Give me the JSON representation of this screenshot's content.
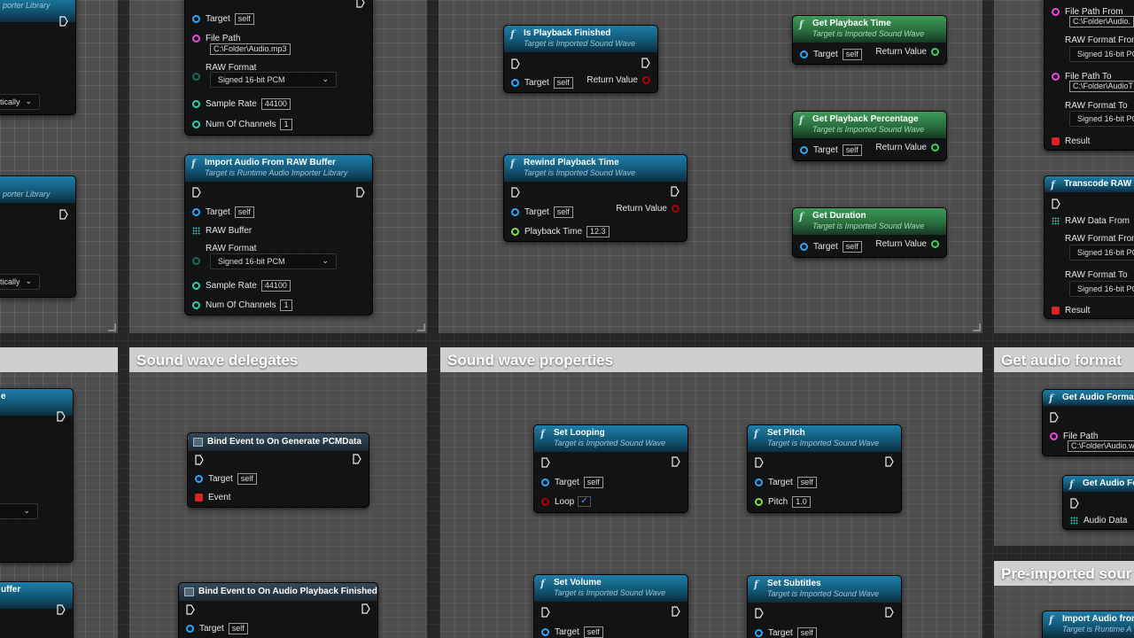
{
  "comments": {
    "sound_wave_delegates": "Sound wave delegates",
    "sound_wave_properties": "Sound wave properties",
    "get_audio_format": "Get audio format",
    "pre_imported_sound": "Pre-imported sour"
  },
  "common": {
    "target": "Target",
    "self": "self",
    "return_value": "Return Value",
    "imported_sound_wave": "Target is Imported Sound Wave",
    "runtime_lib": "Target is Runtime Audio Importer Library",
    "runtime_lib_cut": "Target is Runtime A",
    "raw_format": "RAW Format",
    "signed16": "Signed 16-bit PCM",
    "signed16_cut": "Signed 16-bit PC",
    "sample_rate": "Sample Rate",
    "sample_rate_val": "44100",
    "num_channels": "Num Of Channels",
    "num_channels_val": "1",
    "file_path": "File Path",
    "file_path_val": "C:\\Folder\\Audio.mp3",
    "file_path_val_cut": "C:\\Folder\\Audio.w",
    "result": "Result",
    "event": "Event",
    "tically": "tically",
    "porter_lib": "porter Library",
    "uffer": "uffer",
    "e": "e"
  },
  "nodes": {
    "import_raw": {
      "title": "Import Audio From RAW Buffer",
      "raw_buffer": "RAW Buffer"
    },
    "is_finished": {
      "title": "Is Playback Finished"
    },
    "rewind": {
      "title": "Rewind Playback Time",
      "playback_time": "Playback Time",
      "playback_time_val": "12.3"
    },
    "get_time": {
      "title": "Get Playback Time"
    },
    "get_pct": {
      "title": "Get Playback Percentage"
    },
    "get_duration": {
      "title": "Get Duration"
    },
    "transcode_file": {
      "path_from": "File Path From",
      "path_from_val": "C:\\Folder\\Audio.",
      "raw_from": "RAW Format From",
      "path_to": "File Path To",
      "path_to_val": "C:\\Folder\\AudioT",
      "raw_to": "RAW Format To"
    },
    "transcode_raw": {
      "title": "Transcode RAW Da",
      "raw_data_from": "RAW Data From",
      "raw_from": "RAW Format From",
      "raw_to": "RAW Format To"
    },
    "bind_pcm": {
      "title": "Bind Event to On Generate PCMData"
    },
    "bind_finished": {
      "title": "Bind Event to On Audio Playback Finished"
    },
    "set_looping": {
      "title": "Set Looping",
      "loop": "Loop",
      "loop_val": "✓"
    },
    "set_pitch": {
      "title": "Set Pitch",
      "pitch": "Pitch",
      "pitch_val": "1.0"
    },
    "set_volume": {
      "title": "Set Volume"
    },
    "set_subtitles": {
      "title": "Set Subtitles"
    },
    "get_format": {
      "title": "Get Audio Format"
    },
    "get_format2": {
      "title": "Get Audio For",
      "audio_data": "Audio Data"
    },
    "import_from": {
      "title": "Import Audio from"
    }
  },
  "colors": {
    "function_header": "#125877",
    "pure_header": "#2a6e3e",
    "comment_title": "#cfcfcf"
  }
}
